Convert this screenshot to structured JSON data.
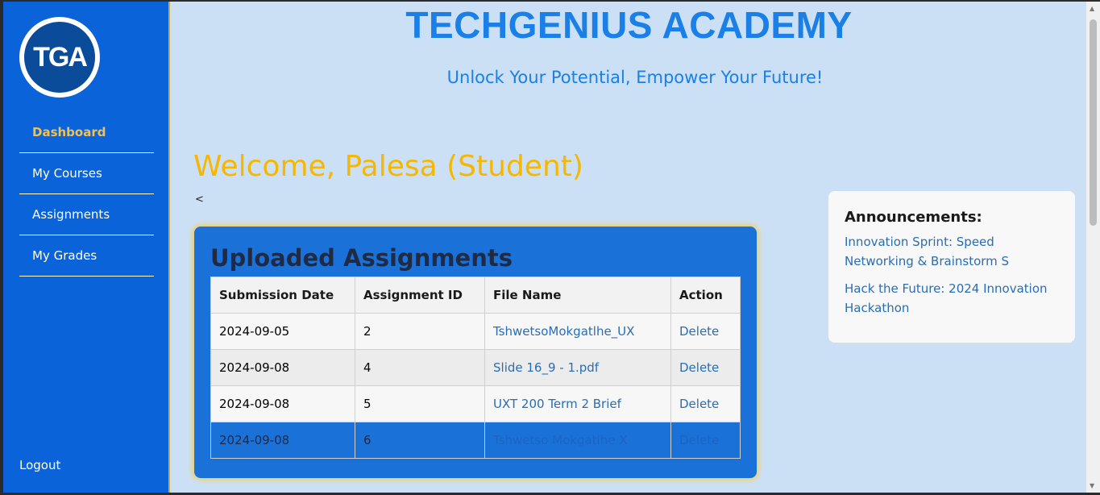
{
  "logo": {
    "text": "TGA"
  },
  "sidebar": {
    "items": [
      {
        "label": "Dashboard",
        "active": true
      },
      {
        "label": "My Courses"
      },
      {
        "label": "Assignments"
      },
      {
        "label": "My Grades"
      }
    ],
    "logout": "Logout"
  },
  "header": {
    "brand": "TECHGENIUS ACADEMY",
    "tagline": "Unlock Your Potential, Empower Your Future!"
  },
  "main": {
    "welcome": "Welcome, Palesa (Student)",
    "back": "<"
  },
  "assignments": {
    "title": "Uploaded Assignments",
    "columns": [
      "Submission Date",
      "Assignment ID",
      "File Name",
      "Action"
    ],
    "rows": [
      {
        "date": "2024-09-05",
        "id": "2",
        "file": "TshwetsoMokgatlhe_UX",
        "action": "Delete"
      },
      {
        "date": "2024-09-08",
        "id": "4",
        "file": "Slide 16_9 - 1.pdf",
        "action": "Delete"
      },
      {
        "date": "2024-09-08",
        "id": "5",
        "file": "UXT 200 Term 2 Brief",
        "action": "Delete"
      },
      {
        "date": "2024-09-08",
        "id": "6",
        "file": "Tshwetso Mokgatlhe X",
        "action": "Delete"
      }
    ]
  },
  "announcements": {
    "title": "Announcements:",
    "items": [
      "Innovation Sprint: Speed Networking & Brainstorm S",
      "Hack the Future: 2024 Innovation Hackathon"
    ]
  },
  "colors": {
    "sidebar": "#0a63d8",
    "accent": "#f5b700",
    "brand": "#1a7fe6",
    "background": "#cce0f5"
  }
}
